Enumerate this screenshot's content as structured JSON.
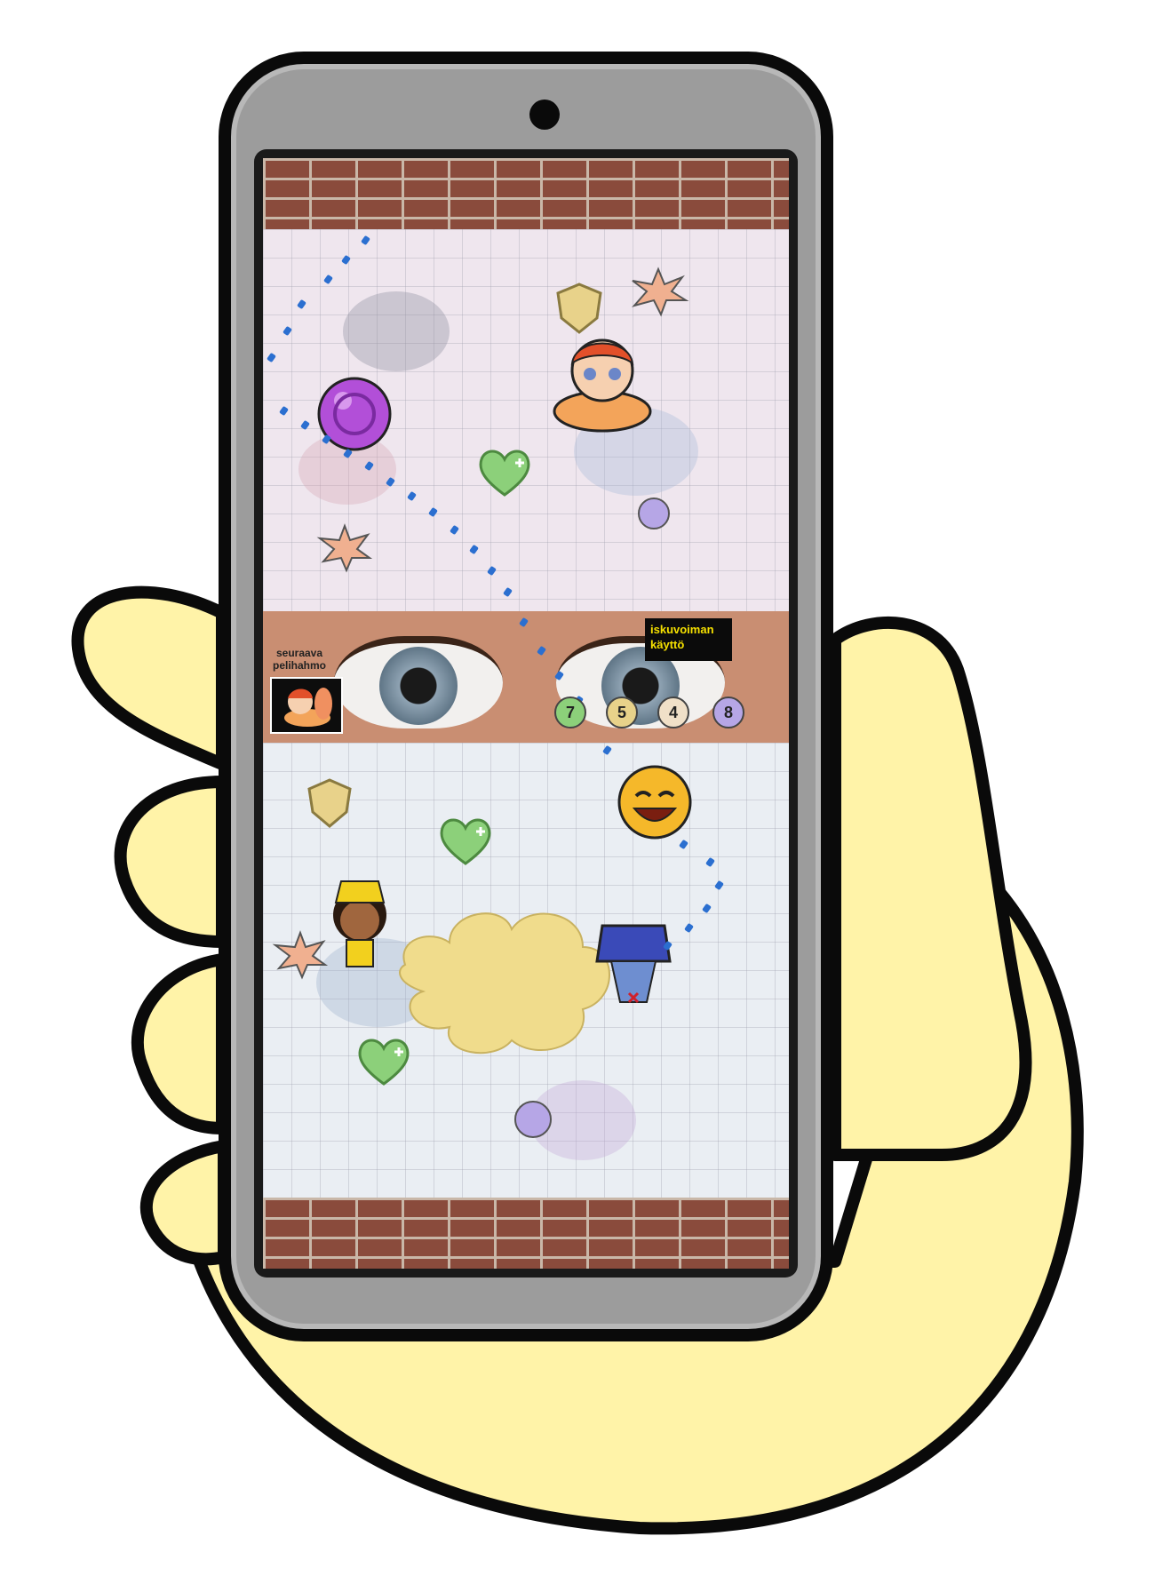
{
  "game": {
    "next_character_label": "seuraava\npelihahmo",
    "power_use_label": "iskuvoiman\nkäyttö",
    "counters": {
      "heart": "7",
      "shield": "5",
      "strike": "4",
      "orb": "8"
    }
  },
  "icons": {
    "heart": "heart-plus-icon",
    "shield": "shield-icon",
    "strike": "impact-burst-icon",
    "orb": "purple-orb-icon",
    "smiley": "laughing-face-icon"
  },
  "colors": {
    "hand": "#fff3a8",
    "phone_body": "#9c9c9c",
    "power_text": "#f5e000",
    "heart_green": "#8cd07a",
    "shield_gold": "#e8d28a",
    "orb_purple": "#b6a6e6",
    "cloud_yellow": "#f0dc8c"
  }
}
